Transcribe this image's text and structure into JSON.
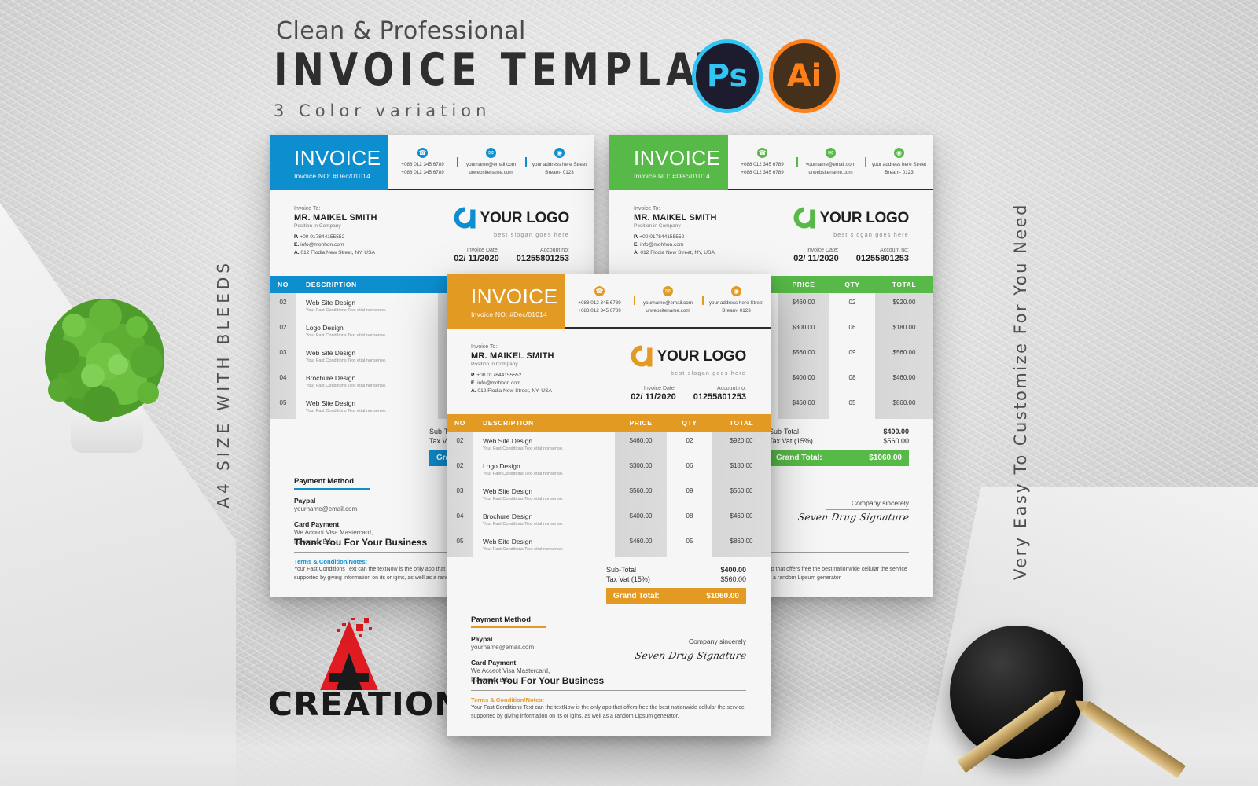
{
  "header": {
    "tagline": "Clean & Professional",
    "title": "INVOICE TEMPLATE",
    "subtitle": "3 Color variation",
    "badges": [
      {
        "name": "photoshop-badge",
        "label": "Ps",
        "ring": "#31c5f4",
        "fill": "#1c1c2e"
      },
      {
        "name": "illustrator-badge",
        "label": "Ai",
        "ring": "#ff7f18",
        "fill": "#45301c"
      }
    ]
  },
  "side_labels": {
    "left": "A4 SIZE WITH BLEEDS",
    "right": "Very Easy To Customize For You Need"
  },
  "brand_logo": {
    "word": "CREATION",
    "letter": "A",
    "red": "#e01b22",
    "black": "#1a1a1a"
  },
  "theme_colors": {
    "blue": "#0d8ecf",
    "green": "#57b947",
    "orange": "#e39a23"
  },
  "invoice": {
    "title": "INVOICE",
    "invoice_no": "Invoice NO: #Dec/01014",
    "contacts": [
      {
        "icon": "phone-icon",
        "glyph": "☎",
        "lines": [
          "+088 012 345 6789",
          "+088 012 345 6789"
        ]
      },
      {
        "icon": "email-icon",
        "glyph": "✉",
        "lines": [
          "yourname@email.com",
          "urwebsitename.com"
        ]
      },
      {
        "icon": "location-icon",
        "glyph": "◉",
        "lines": [
          "your address here Street",
          "Bream- 0123"
        ]
      }
    ],
    "bill_to": {
      "label": "Invoice To:",
      "name": "MR. MAIKEL SMITH",
      "position": "Position in Company",
      "phone_key": "P.",
      "phone": "+00 017844155552",
      "email_key": "E.",
      "email": "info@mohhon.com",
      "address_key": "A.",
      "address": "012 Flodia  New Street, NY, USA"
    },
    "logo": {
      "text": "YOUR LOGO",
      "slogan": "best slogan goes here"
    },
    "meta": {
      "date_label": "Invoice Date:",
      "date_value": "02/ 11/2020",
      "account_label": "Account no:",
      "account_value": "01255801253"
    },
    "table": {
      "columns": [
        "NO",
        "DESCRIPTION",
        "PRICE",
        "QTY",
        "TOTAL"
      ],
      "rows": [
        {
          "no": "02",
          "title": "Web Site Design",
          "sub": "Your Fast Conditions Text etial nonsense.",
          "price": "$460.00",
          "qty": "02",
          "total": "$920.00"
        },
        {
          "no": "02",
          "title": "Logo Design",
          "sub": "Your Fast Conditions Text etial nonsense.",
          "price": "$300.00",
          "qty": "06",
          "total": "$180.00"
        },
        {
          "no": "03",
          "title": "Web Site Design",
          "sub": "Your Fast Conditions Text etial nonsense.",
          "price": "$560.00",
          "qty": "09",
          "total": "$560.00"
        },
        {
          "no": "04",
          "title": "Brochure Design",
          "sub": "Your Fast Conditions Text etial nonsense.",
          "price": "$400.00",
          "qty": "08",
          "total": "$460.00"
        },
        {
          "no": "05",
          "title": "Web Site Design",
          "sub": "Your Fast Conditions Text etial nonsense.",
          "price": "$460.00",
          "qty": "05",
          "total": "$860.00"
        }
      ]
    },
    "totals": {
      "subtotal_label": "Sub-Total",
      "subtotal_value": "$400.00",
      "tax_label": "Tax Vat (15%)",
      "tax_value": "$560.00",
      "grand_label": "Grand Total:",
      "grand_value": "$1060.00"
    },
    "payment": {
      "heading": "Payment Method",
      "paypal_label": "Paypal",
      "paypal_value": "yourname@email.com",
      "card_label": "Card Payment",
      "card_value": "We Acceot Visa Mastercard,\nPayoneer Etc."
    },
    "signature": {
      "company": "Company sincerely",
      "name": "Seven Drug Signature"
    },
    "footer": {
      "thanks": "Thank You For Your Business",
      "terms_heading": "Terms & Condition/Notes:",
      "terms_body": "Your Fast Conditions Text can the textNow is the only app that offers free the best nationwide cellular the  service supported by giving information on its or igins, as well as a random Lipsum generator."
    }
  }
}
